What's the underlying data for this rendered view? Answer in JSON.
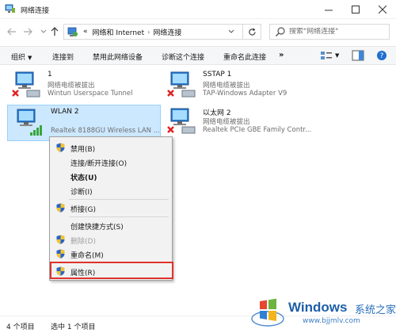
{
  "window": {
    "title": "网络连接"
  },
  "address": {
    "root_marker": "«",
    "crumbs": [
      "网络和 Internet",
      "网络连接"
    ]
  },
  "search": {
    "placeholder": "搜索\"网络连接\""
  },
  "toolbar": {
    "organize": "组织",
    "connect_to": "连接到",
    "disable_device": "禁用此网络设备",
    "diagnose": "诊断这个连接",
    "rename": "重命名此连接",
    "more": "»"
  },
  "connections": [
    {
      "name": "1",
      "status": "网络电缆被拔出",
      "device": "Wintun Userspace Tunnel",
      "disconnected": true,
      "type": "wired"
    },
    {
      "name": "SSTAP 1",
      "status": "网络电缆被拔出",
      "device": "TAP-Windows Adapter V9",
      "disconnected": true,
      "type": "wired"
    },
    {
      "name": "WLAN 2",
      "status": "",
      "device": "Realtek 8188GU Wireless LAN ...",
      "disconnected": false,
      "type": "wireless",
      "selected": true
    },
    {
      "name": "以太网 2",
      "status": "网络电缆被拔出",
      "device": "Realtek PCIe GBE Family Contr...",
      "disconnected": true,
      "type": "wired"
    }
  ],
  "context_menu": {
    "items": [
      {
        "label": "禁用(B)",
        "shield": true,
        "bold": false,
        "disabled": false
      },
      {
        "label": "连接/断开连接(O)",
        "shield": false,
        "bold": false,
        "disabled": false
      },
      {
        "label": "状态(U)",
        "shield": false,
        "bold": true,
        "disabled": false
      },
      {
        "label": "诊断(I)",
        "shield": false,
        "bold": false,
        "disabled": false
      },
      {
        "label": "桥接(G)",
        "shield": true,
        "bold": false,
        "disabled": false
      },
      {
        "label": "创建快捷方式(S)",
        "shield": false,
        "bold": false,
        "disabled": false
      },
      {
        "label": "删除(D)",
        "shield": true,
        "bold": false,
        "disabled": true
      },
      {
        "label": "重命名(M)",
        "shield": true,
        "bold": false,
        "disabled": false
      },
      {
        "label": "属性(R)",
        "shield": true,
        "bold": false,
        "disabled": false,
        "highlighted": true
      }
    ]
  },
  "statusbar": {
    "count": "4 个项目",
    "selected": "选中 1 个项目"
  },
  "watermark": {
    "brand": "Windows",
    "brand_cn": "系统之家",
    "url": "www.bjjmlv.com"
  },
  "colors": {
    "selection_bg": "#cce8ff",
    "highlight_red": "#e0322d",
    "accent_blue": "#1f5fa8"
  }
}
